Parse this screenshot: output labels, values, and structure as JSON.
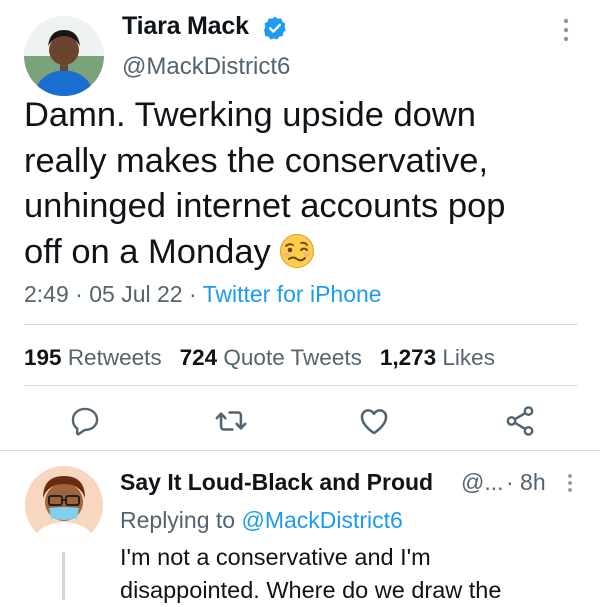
{
  "tweet": {
    "author_name": "Tiara Mack",
    "author_handle": "@MackDistrict6",
    "text": "Damn. Twerking upside down\nreally makes the conservative,\nunhinged internet accounts pop\noff on a Monday",
    "emoji": "woozy-face-emoji",
    "time": "2:49",
    "separator": " · ",
    "date": "05 Jul 22",
    "source": "Twitter for iPhone",
    "stats": {
      "retweets_count": "195",
      "retweets_label": "Retweets",
      "quotes_count": "724",
      "quotes_label": "Quote Tweets",
      "likes_count": "1,273",
      "likes_label": "Likes"
    },
    "actions": [
      "reply-icon",
      "retweet-icon",
      "like-icon",
      "share-icon"
    ]
  },
  "reply": {
    "author_name": "Say It Loud-Black and Proud",
    "author_handle": "@...",
    "time": "· 8h",
    "replying_prefix": "Replying to ",
    "replying_to": "@MackDistrict6",
    "text": "I'm not a conservative and I'm\ndisappointed.  Where do we draw the"
  },
  "colors": {
    "text": "#0f1419",
    "secondary": "#536471",
    "link": "#1d9bf0",
    "verified": "#1d9bf0",
    "divider": "#d5dbe0"
  }
}
